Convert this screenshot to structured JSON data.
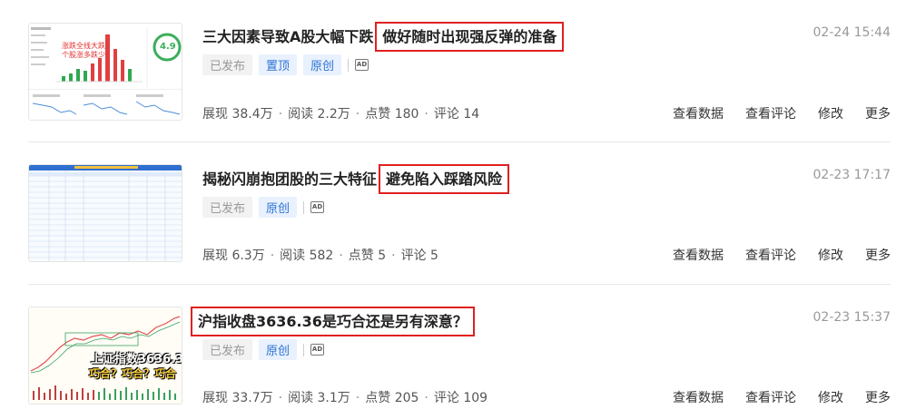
{
  "articles": [
    {
      "title": "三大因素导致A股大幅下跌",
      "highlight": "做好随时出现强反弹的准备",
      "date": "02-24 15:44",
      "tags": [
        "已发布",
        "置顶",
        "原创"
      ],
      "ad_label": "AD",
      "stats": {
        "impressions": "展现 38.4万",
        "reads": "阅读 2.2万",
        "likes": "点赞 180",
        "comments": "评论 14"
      },
      "thumb_caption": "涨跌全线大跌 个股涨多跌少",
      "thumb_number": "4.9"
    },
    {
      "title": "揭秘闪崩抱团股的三大特征",
      "highlight": "避免陷入踩踏风险",
      "date": "02-23 17:17",
      "tags": [
        "已发布",
        "原创"
      ],
      "ad_label": "AD",
      "stats": {
        "impressions": "展现 6.3万",
        "reads": "阅读 582",
        "likes": "点赞 5",
        "comments": "评论 5"
      }
    },
    {
      "title": "",
      "highlight": "沪指收盘3636.36是巧合还是另有深意？",
      "date": "02-23 15:37",
      "tags": [
        "已发布",
        "原创"
      ],
      "ad_label": "AD",
      "stats": {
        "impressions": "展现 33.7万",
        "reads": "阅读 3.1万",
        "likes": "点赞 205",
        "comments": "评论 109"
      },
      "thumb_line1": "上证指数3636.3",
      "thumb_line2": "巧合？巧合？巧合"
    }
  ],
  "actions": {
    "data": "查看数据",
    "comments": "查看评论",
    "edit": "修改",
    "more": "更多"
  },
  "colors": {
    "highlight_border": "#e02020",
    "tag_blue": "#2e73d6"
  }
}
